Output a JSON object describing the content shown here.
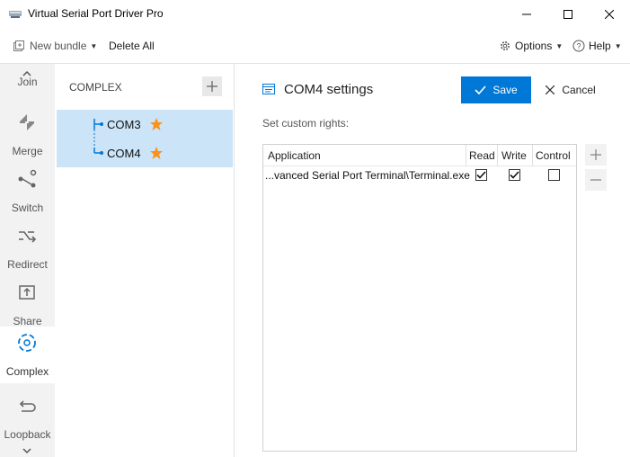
{
  "window": {
    "title": "Virtual Serial Port Driver Pro"
  },
  "toolbar": {
    "new_bundle_label": "New bundle",
    "delete_all_label": "Delete All",
    "options_label": "Options",
    "help_label": "Help"
  },
  "nav": {
    "items": [
      {
        "label": "Join",
        "icon": "join-icon"
      },
      {
        "label": "Merge",
        "icon": "merge-icon"
      },
      {
        "label": "Switch",
        "icon": "switch-icon"
      },
      {
        "label": "Redirect",
        "icon": "redirect-icon"
      },
      {
        "label": "Share",
        "icon": "share-icon"
      },
      {
        "label": "Complex",
        "icon": "complex-icon",
        "active": true
      },
      {
        "label": "Loopback",
        "icon": "loopback-icon"
      }
    ]
  },
  "bundles": {
    "title": "COMPLEX",
    "ports": [
      {
        "name": "COM3",
        "starred": true
      },
      {
        "name": "COM4",
        "starred": true
      }
    ]
  },
  "settings": {
    "title": "COM4 settings",
    "save_label": "Save",
    "cancel_label": "Cancel",
    "custom_rights_label": "Set custom rights:",
    "columns": [
      "Application",
      "Read",
      "Write",
      "Control"
    ],
    "rows": [
      {
        "application": "...vanced Serial Port Terminal\\Terminal.exe",
        "read": true,
        "write": true,
        "control": false
      }
    ]
  },
  "colors": {
    "accent": "#0078d7",
    "selection": "#cce4f7",
    "star": "#f7931e",
    "nav_bg": "#f2f2f2"
  }
}
